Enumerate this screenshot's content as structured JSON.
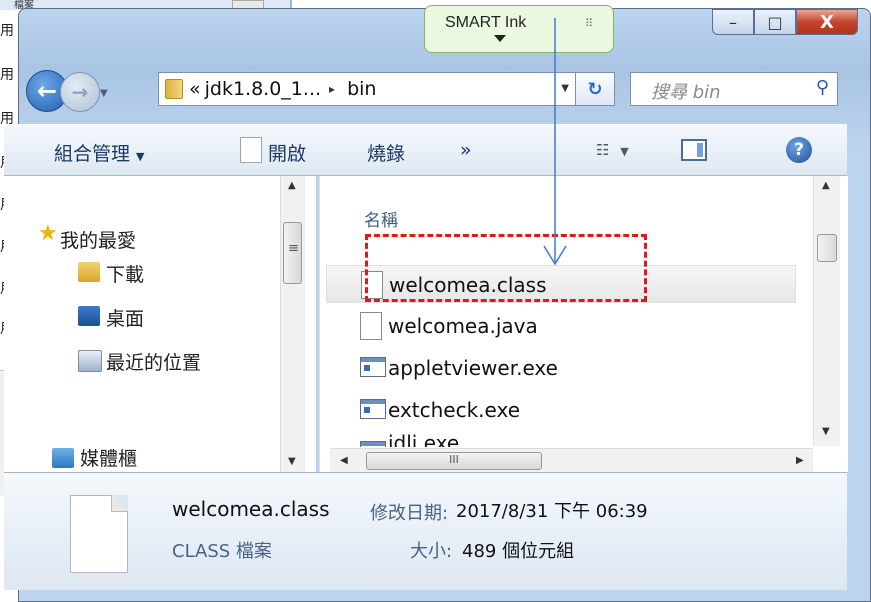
{
  "background_window": {
    "title": "檔案",
    "side_labels": [
      "用",
      "用",
      "用",
      "用",
      "用",
      "用",
      "用",
      "用"
    ]
  },
  "smart_ink": {
    "label": "SMART Ink",
    "grip": "⠿"
  },
  "window_controls": {
    "minimize": "–",
    "maximize": "□",
    "close": "X"
  },
  "nav": {
    "back": "←",
    "forward": "→",
    "dropdown": "▼"
  },
  "address": {
    "prefix": "«",
    "crumbs": [
      "jdk1.8.0_1...",
      "bin"
    ],
    "separator": "▸",
    "dropdown": "▼"
  },
  "refresh_icon": "↻",
  "search": {
    "placeholder": "搜尋 bin",
    "icon": "⚲"
  },
  "toolbar": {
    "organize": "組合管理",
    "dropdown": "▼",
    "open": "開啟",
    "burn": "燒錄",
    "more": "»",
    "view_icon": "☷",
    "help": "?"
  },
  "nav_pane": {
    "items": [
      {
        "label": "我的最愛",
        "icon": "star-icon"
      },
      {
        "label": "下載",
        "icon": "downloads-icon"
      },
      {
        "label": "桌面",
        "icon": "desktop-icon"
      },
      {
        "label": "最近的位置",
        "icon": "recent-places-icon"
      },
      {
        "label": "媒體櫃",
        "icon": "libraries-icon"
      }
    ]
  },
  "file_pane": {
    "column_header": "名稱",
    "files": [
      {
        "name": "welcomea.class",
        "icon": "document-icon",
        "selected": true
      },
      {
        "name": "welcomea.java",
        "icon": "document-icon",
        "selected": false
      },
      {
        "name": "appletviewer.exe",
        "icon": "exe-icon",
        "selected": false
      },
      {
        "name": "extcheck.exe",
        "icon": "exe-icon",
        "selected": false
      },
      {
        "name": "idlj.exe",
        "icon": "exe-icon",
        "selected": false
      }
    ],
    "scroll_grip": "III"
  },
  "details": {
    "file_name": "welcomea.class",
    "file_type": "CLASS 檔案",
    "modified_label": "修改日期:",
    "modified_value": "2017/8/31 下午 06:39",
    "size_label": "大小:",
    "size_value": "489 個位元組"
  },
  "colors": {
    "highlight_dashed": "#e01818",
    "annotation_arrow": "#3a7ad6",
    "close_button": "#c4452e",
    "smart_ink_bg": "#eaf8e0"
  }
}
